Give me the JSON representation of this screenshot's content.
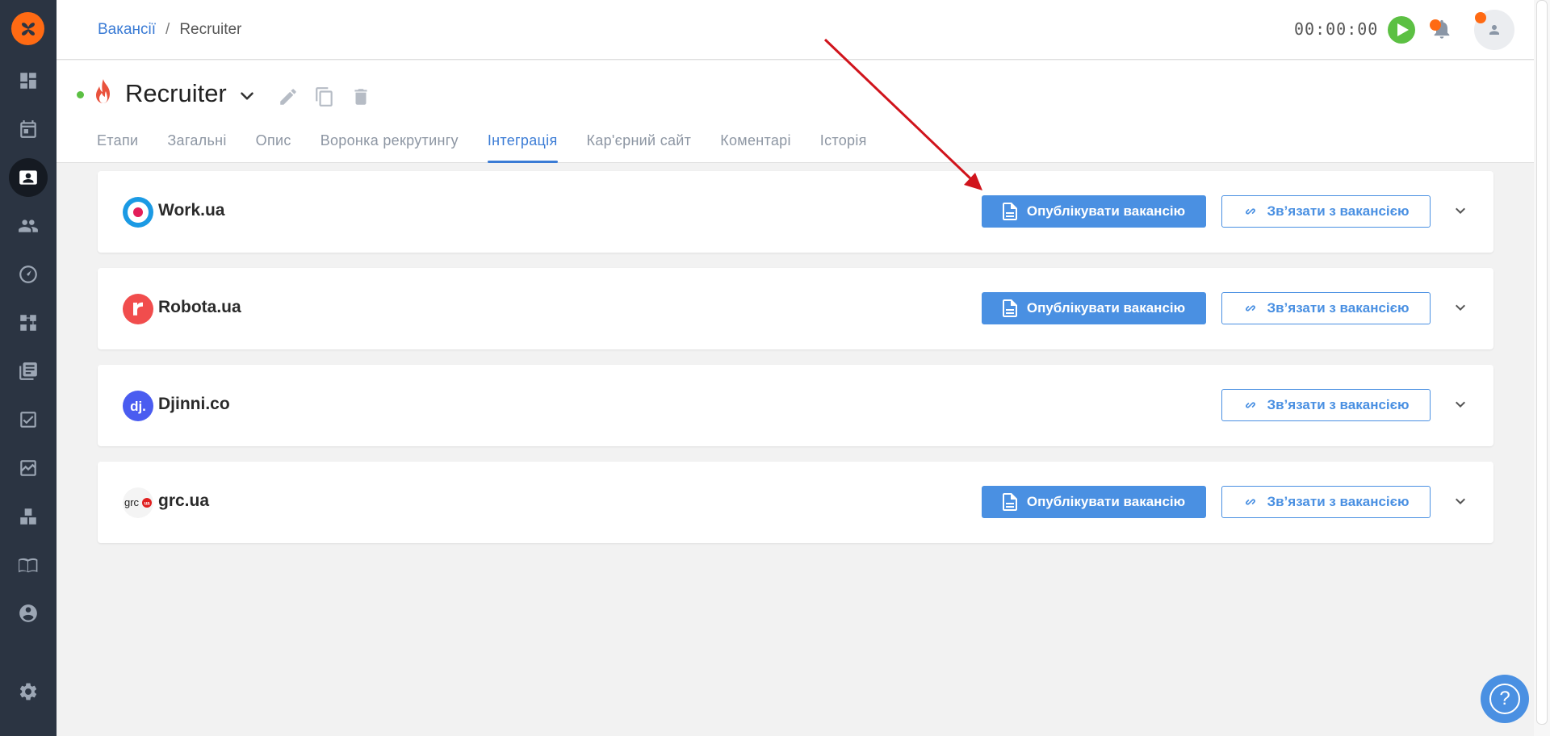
{
  "breadcrumb": {
    "root": "Вакансії",
    "separator": "/",
    "current": "Recruiter"
  },
  "timer": {
    "value": "00:00:00"
  },
  "vacancy": {
    "title": "Recruiter"
  },
  "tabs": [
    {
      "label": "Етапи",
      "active": false
    },
    {
      "label": "Загальні",
      "active": false
    },
    {
      "label": "Опис",
      "active": false
    },
    {
      "label": "Воронка рекрутингу",
      "active": false
    },
    {
      "label": "Інтеграція",
      "active": true
    },
    {
      "label": "Кар'єрний сайт",
      "active": false
    },
    {
      "label": "Коментарі",
      "active": false
    },
    {
      "label": "Історія",
      "active": false
    }
  ],
  "integrations": [
    {
      "name": "Work.ua",
      "has_publish": true
    },
    {
      "name": "Robota.ua",
      "has_publish": true
    },
    {
      "name": "Djinni.co",
      "has_publish": false
    },
    {
      "name": "grc.ua",
      "has_publish": true
    }
  ],
  "buttons": {
    "publish_label": "Опублікувати вакансію",
    "link_label": "Зв’язати з вакансією"
  },
  "logos": {
    "djinni_text": "dj.",
    "grc_text": "grc",
    "grc_badge": "ua"
  },
  "help": {
    "symbol": "?"
  },
  "colors": {
    "accent": "#4a90e2",
    "brand_orange": "#ff6a13",
    "sidebar": "#2b3442",
    "status_green": "#5cc043",
    "annotation_arrow": "#d0141c"
  },
  "sidebar_icons": [
    "dashboard-icon",
    "calendar-icon",
    "vacancies-icon",
    "candidates-icon",
    "gauge-icon",
    "pipeline-icon",
    "library-icon",
    "tasks-icon",
    "analytics-icon",
    "integrations-icon",
    "knowledge-icon",
    "profile-icon",
    "settings-icon"
  ]
}
